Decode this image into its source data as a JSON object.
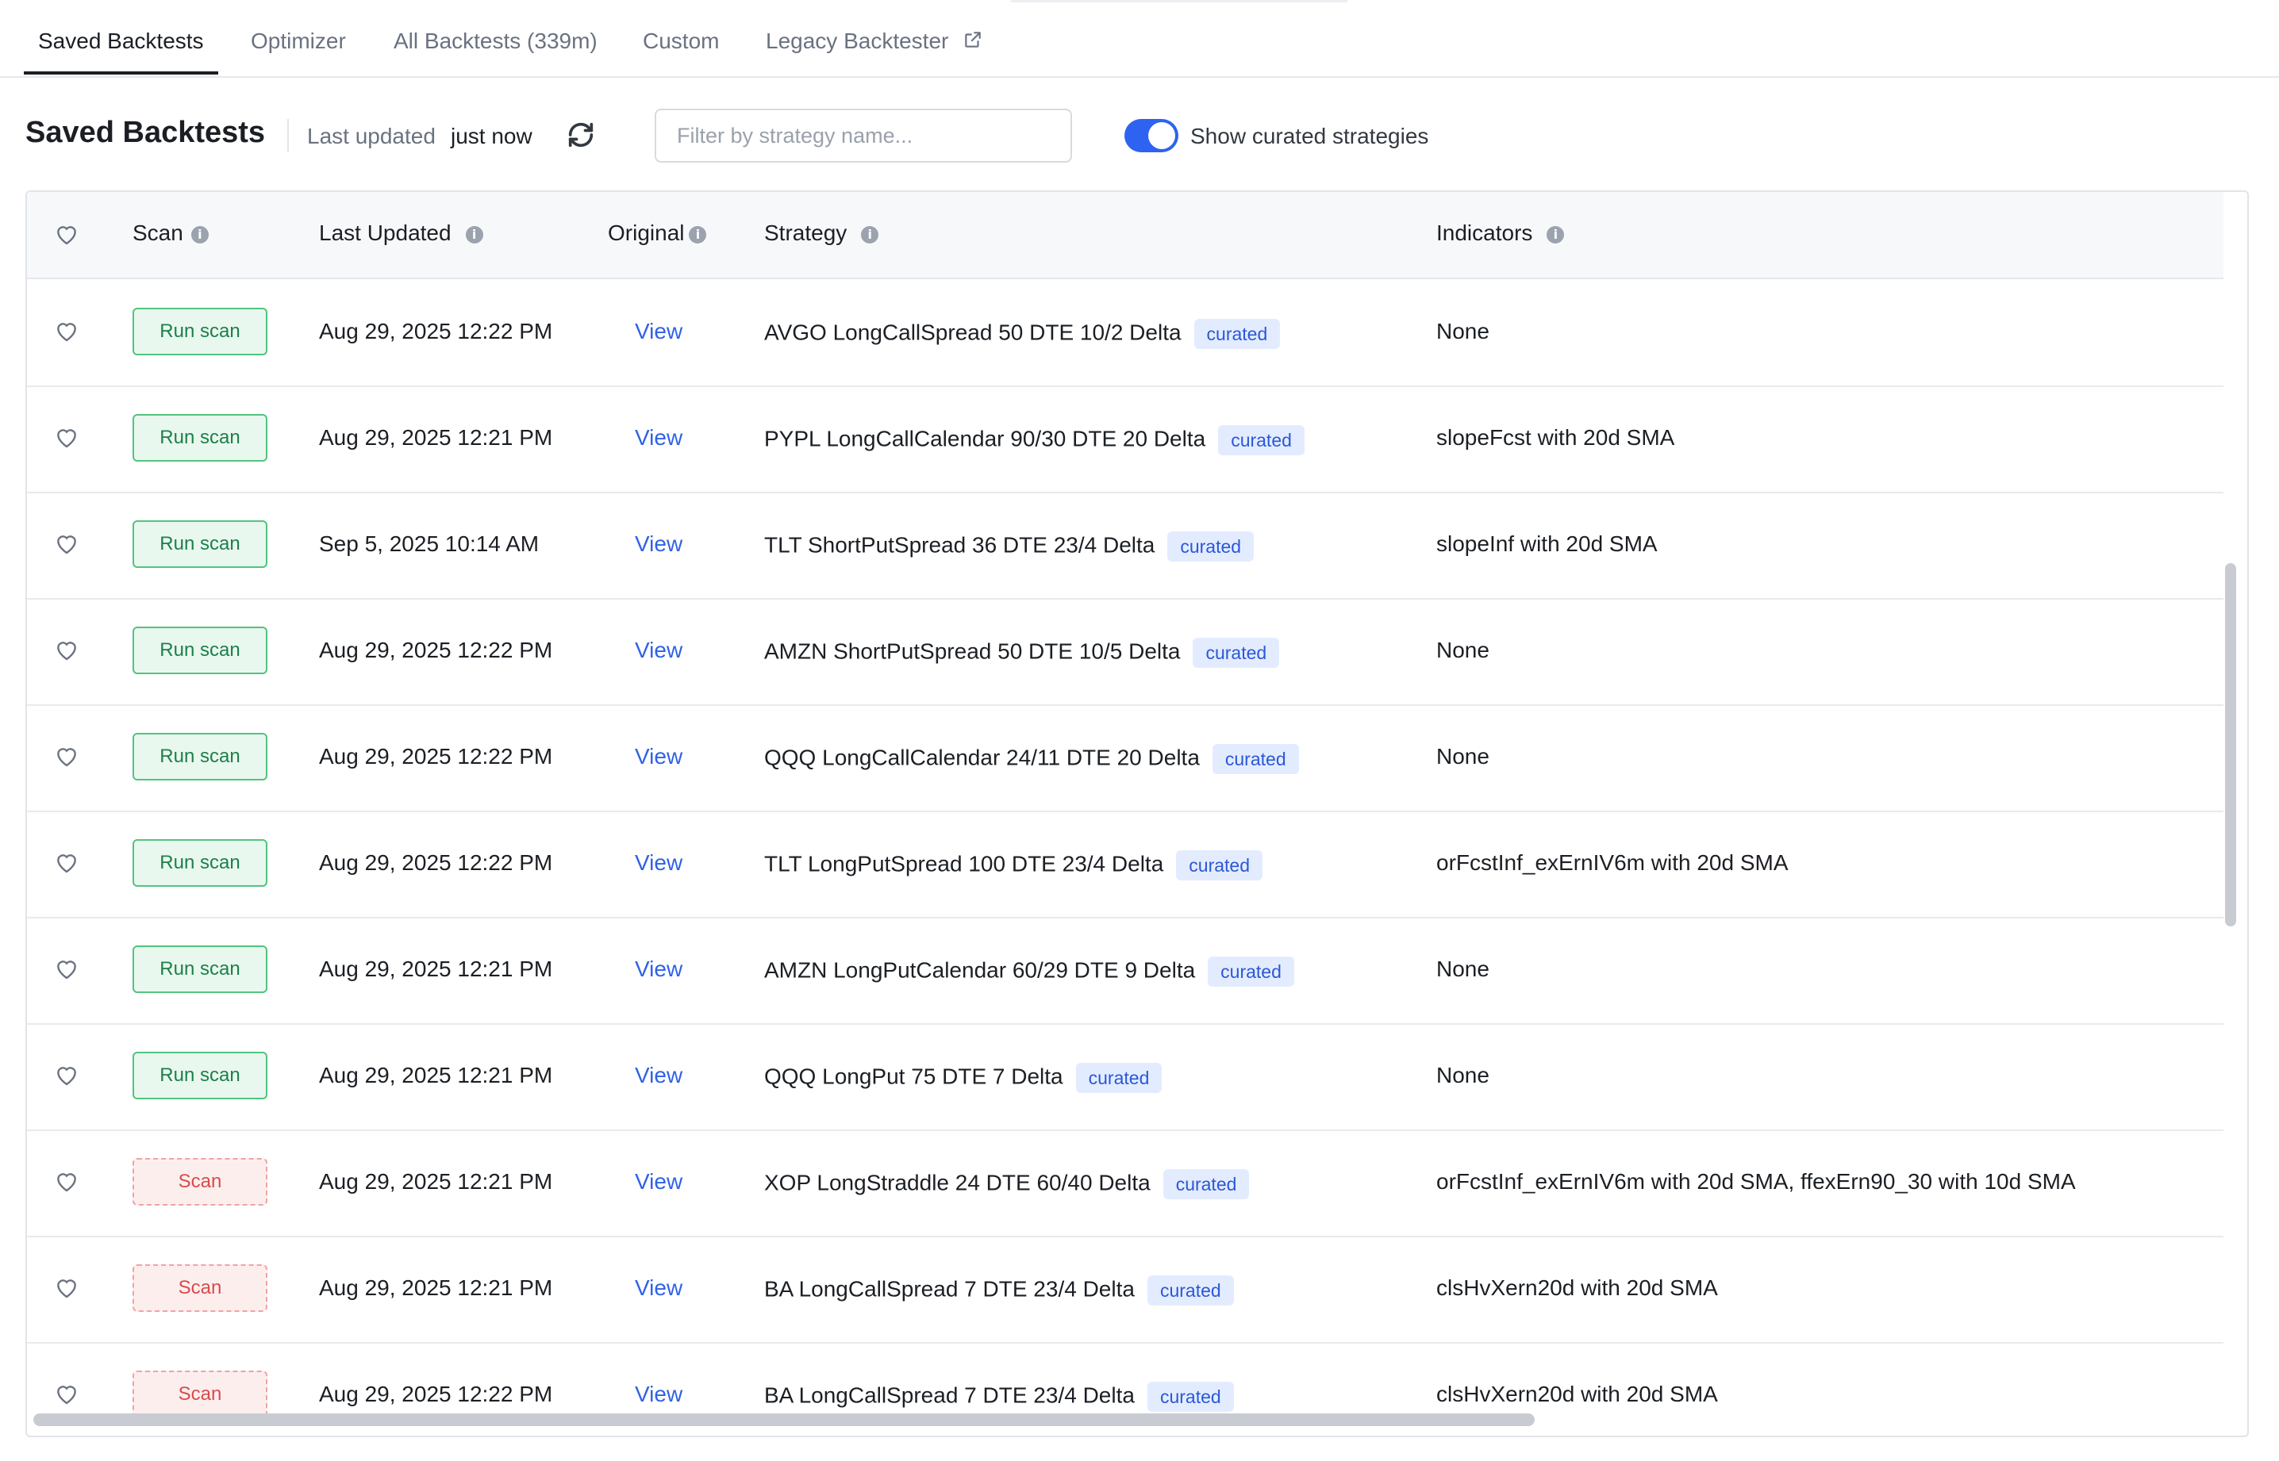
{
  "tabs": [
    {
      "label": "Saved Backtests",
      "active": true
    },
    {
      "label": "Optimizer",
      "active": false
    },
    {
      "label": "All Backtests (339m)",
      "active": false
    },
    {
      "label": "Custom",
      "active": false
    },
    {
      "label": "Legacy Backtester",
      "active": false,
      "icon": "external-link-icon"
    }
  ],
  "header": {
    "title": "Saved Backtests",
    "updated_label": "Last updated",
    "updated_value": "just now",
    "filter_placeholder": "Filter by strategy name...",
    "toggle_label": "Show curated strategies",
    "toggle_on": true
  },
  "table": {
    "columns": [
      "Scan",
      "Last Updated",
      "Original",
      "Strategy",
      "Indicators"
    ],
    "rows": [
      {
        "scan": "Run scan",
        "scan_type": "run",
        "updated": "Aug 29, 2025 12:22 PM",
        "original": "View",
        "strategy": "AVGO LongCallSpread 50 DTE 10/2 Delta",
        "badge": "curated",
        "indicators": "None"
      },
      {
        "scan": "Run scan",
        "scan_type": "run",
        "updated": "Aug 29, 2025 12:21 PM",
        "original": "View",
        "strategy": "PYPL LongCallCalendar 90/30 DTE 20 Delta",
        "badge": "curated",
        "indicators": "slopeFcst with 20d SMA"
      },
      {
        "scan": "Run scan",
        "scan_type": "run",
        "updated": "Sep 5, 2025 10:14 AM",
        "original": "View",
        "strategy": "TLT ShortPutSpread 36 DTE 23/4 Delta",
        "badge": "curated",
        "indicators": "slopeInf with 20d SMA"
      },
      {
        "scan": "Run scan",
        "scan_type": "run",
        "updated": "Aug 29, 2025 12:22 PM",
        "original": "View",
        "strategy": "AMZN ShortPutSpread 50 DTE 10/5 Delta",
        "badge": "curated",
        "indicators": "None"
      },
      {
        "scan": "Run scan",
        "scan_type": "run",
        "updated": "Aug 29, 2025 12:22 PM",
        "original": "View",
        "strategy": "QQQ LongCallCalendar 24/11 DTE 20 Delta",
        "badge": "curated",
        "indicators": "None"
      },
      {
        "scan": "Run scan",
        "scan_type": "run",
        "updated": "Aug 29, 2025 12:22 PM",
        "original": "View",
        "strategy": "TLT LongPutSpread 100 DTE 23/4 Delta",
        "badge": "curated",
        "indicators": "orFcstInf_exErnIV6m with 20d SMA"
      },
      {
        "scan": "Run scan",
        "scan_type": "run",
        "updated": "Aug 29, 2025 12:21 PM",
        "original": "View",
        "strategy": "AMZN LongPutCalendar 60/29 DTE 9 Delta",
        "badge": "curated",
        "indicators": "None"
      },
      {
        "scan": "Run scan",
        "scan_type": "run",
        "updated": "Aug 29, 2025 12:21 PM",
        "original": "View",
        "strategy": "QQQ LongPut 75 DTE 7 Delta",
        "badge": "curated",
        "indicators": "None"
      },
      {
        "scan": "Scan",
        "scan_type": "disabled",
        "updated": "Aug 29, 2025 12:21 PM",
        "original": "View",
        "strategy": "XOP LongStraddle 24 DTE 60/40 Delta",
        "badge": "curated",
        "indicators": "orFcstInf_exErnIV6m with 20d SMA, ffexErn90_30 with 10d SMA"
      },
      {
        "scan": "Scan",
        "scan_type": "disabled",
        "updated": "Aug 29, 2025 12:21 PM",
        "original": "View",
        "strategy": "BA LongCallSpread 7 DTE 23/4 Delta",
        "badge": "curated",
        "indicators": "clsHvXern20d with 20d SMA"
      },
      {
        "scan": "Scan",
        "scan_type": "disabled",
        "updated": "Aug 29, 2025 12:22 PM",
        "original": "View",
        "strategy": "BA LongCallSpread 7 DTE 23/4 Delta",
        "badge": "curated",
        "indicators": "clsHvXern20d with 20d SMA"
      }
    ]
  },
  "colors": {
    "accent": "#2d63f0",
    "run_green": "#52c47f",
    "scan_red": "#d94b4b",
    "badge_bg": "#e3ecff"
  }
}
